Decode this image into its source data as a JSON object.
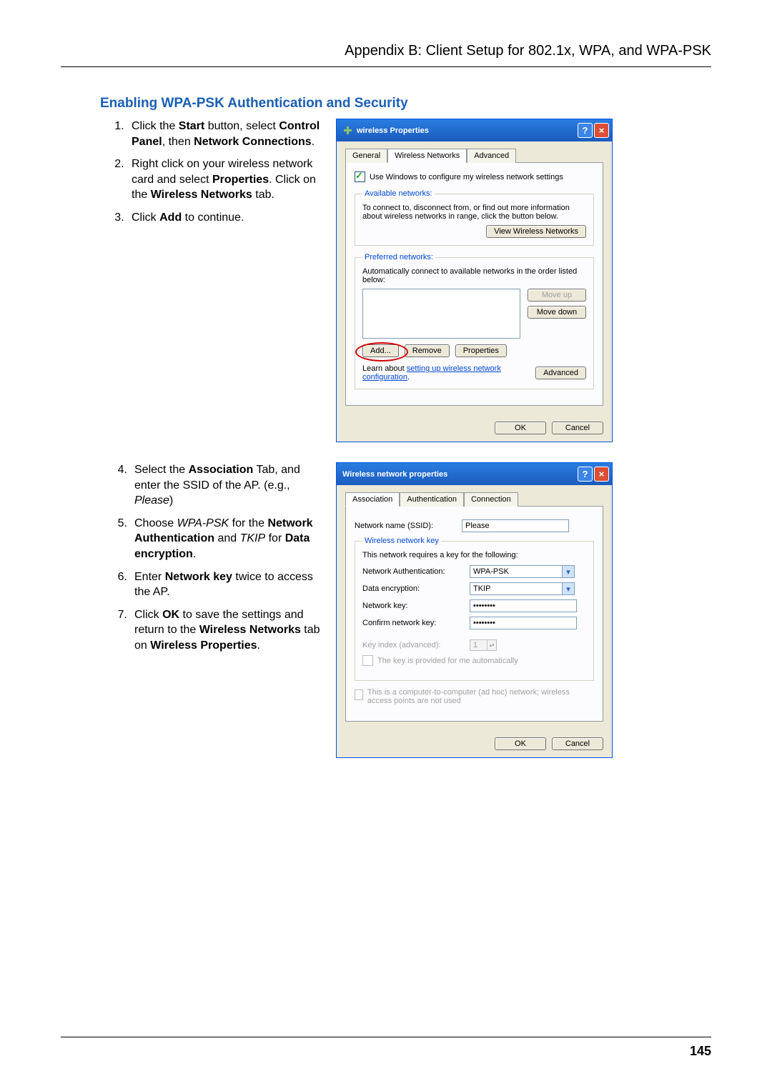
{
  "header": "Appendix B: Client Setup for 802.1x, WPA, and WPA-PSK",
  "section_title": "Enabling WPA-PSK Authentication and Security",
  "page_number": "145",
  "steps_a": [
    {
      "pre": "Click the ",
      "b1": "Start",
      "mid1": " button, select ",
      "b2": "Control Panel",
      "mid2": ", then ",
      "b3": "Network Connections",
      "post": "."
    },
    {
      "pre": "Right click on your wireless network card and select ",
      "b1": "Properties",
      "mid1": ". Click on the ",
      "b2": "Wireless Networks",
      "post": " tab."
    },
    {
      "pre": "Click ",
      "b1": "Add",
      "post": " to continue."
    }
  ],
  "steps_b": [
    {
      "n": "4.",
      "pre": "Select the ",
      "b1": "Association",
      "mid1": " Tab, and enter the SSID of the AP. (e.g., ",
      "i1": "Please",
      "post": ")"
    },
    {
      "n": "5.",
      "pre": "Choose ",
      "i1": "WPA-PSK",
      "mid1": " for the ",
      "b1": "Network Authentication",
      "mid2": " and ",
      "i2": "TKIP",
      "mid3": " for ",
      "b2": "Data encryption",
      "post": "."
    },
    {
      "n": "6.",
      "pre": "Enter ",
      "b1": "Network key",
      "post": " twice to access the AP."
    },
    {
      "n": "7.",
      "pre": "Click ",
      "b1": "OK",
      "mid1": " to save the settings and return to the ",
      "b2": "Wireless Networks",
      "mid2": " tab on ",
      "b3": "Wireless Properties",
      "post": "."
    }
  ],
  "dlg1": {
    "title": "wireless Properties",
    "tabs": {
      "general": "General",
      "wn": "Wireless Networks",
      "adv": "Advanced"
    },
    "use_windows": "Use Windows to configure my wireless network settings",
    "avail_legend": "Available networks:",
    "avail_text": "To connect to, disconnect from, or find out more information about wireless networks in range, click the button below.",
    "view_btn": "View Wireless Networks",
    "pref_legend": "Preferred networks:",
    "pref_text": "Automatically connect to available networks in the order listed below:",
    "move_up": "Move up",
    "move_down": "Move down",
    "add": "Add...",
    "remove": "Remove",
    "properties": "Properties",
    "learn_pre": "Learn about ",
    "learn_link": "setting up wireless network configuration",
    "learn_post": ".",
    "advanced": "Advanced",
    "ok": "OK",
    "cancel": "Cancel"
  },
  "dlg2": {
    "title": "Wireless network properties",
    "tabs": {
      "assoc": "Association",
      "auth": "Authentication",
      "conn": "Connection"
    },
    "ssid_label": "Network name (SSID):",
    "ssid_value": "Please",
    "key_legend": "Wireless network key",
    "key_text": "This network requires a key for the following:",
    "na_label": "Network Authentication:",
    "na_value": "WPA-PSK",
    "de_label": "Data encryption:",
    "de_value": "TKIP",
    "nk_label": "Network key:",
    "nk_value": "••••••••",
    "cnk_label": "Confirm network key:",
    "cnk_value": "••••••••",
    "ki_label": "Key index (advanced):",
    "ki_value": "1",
    "auto_key": "The key is provided for me automatically",
    "adhoc": "This is a computer-to-computer (ad hoc) network; wireless access points are not used",
    "ok": "OK",
    "cancel": "Cancel"
  }
}
